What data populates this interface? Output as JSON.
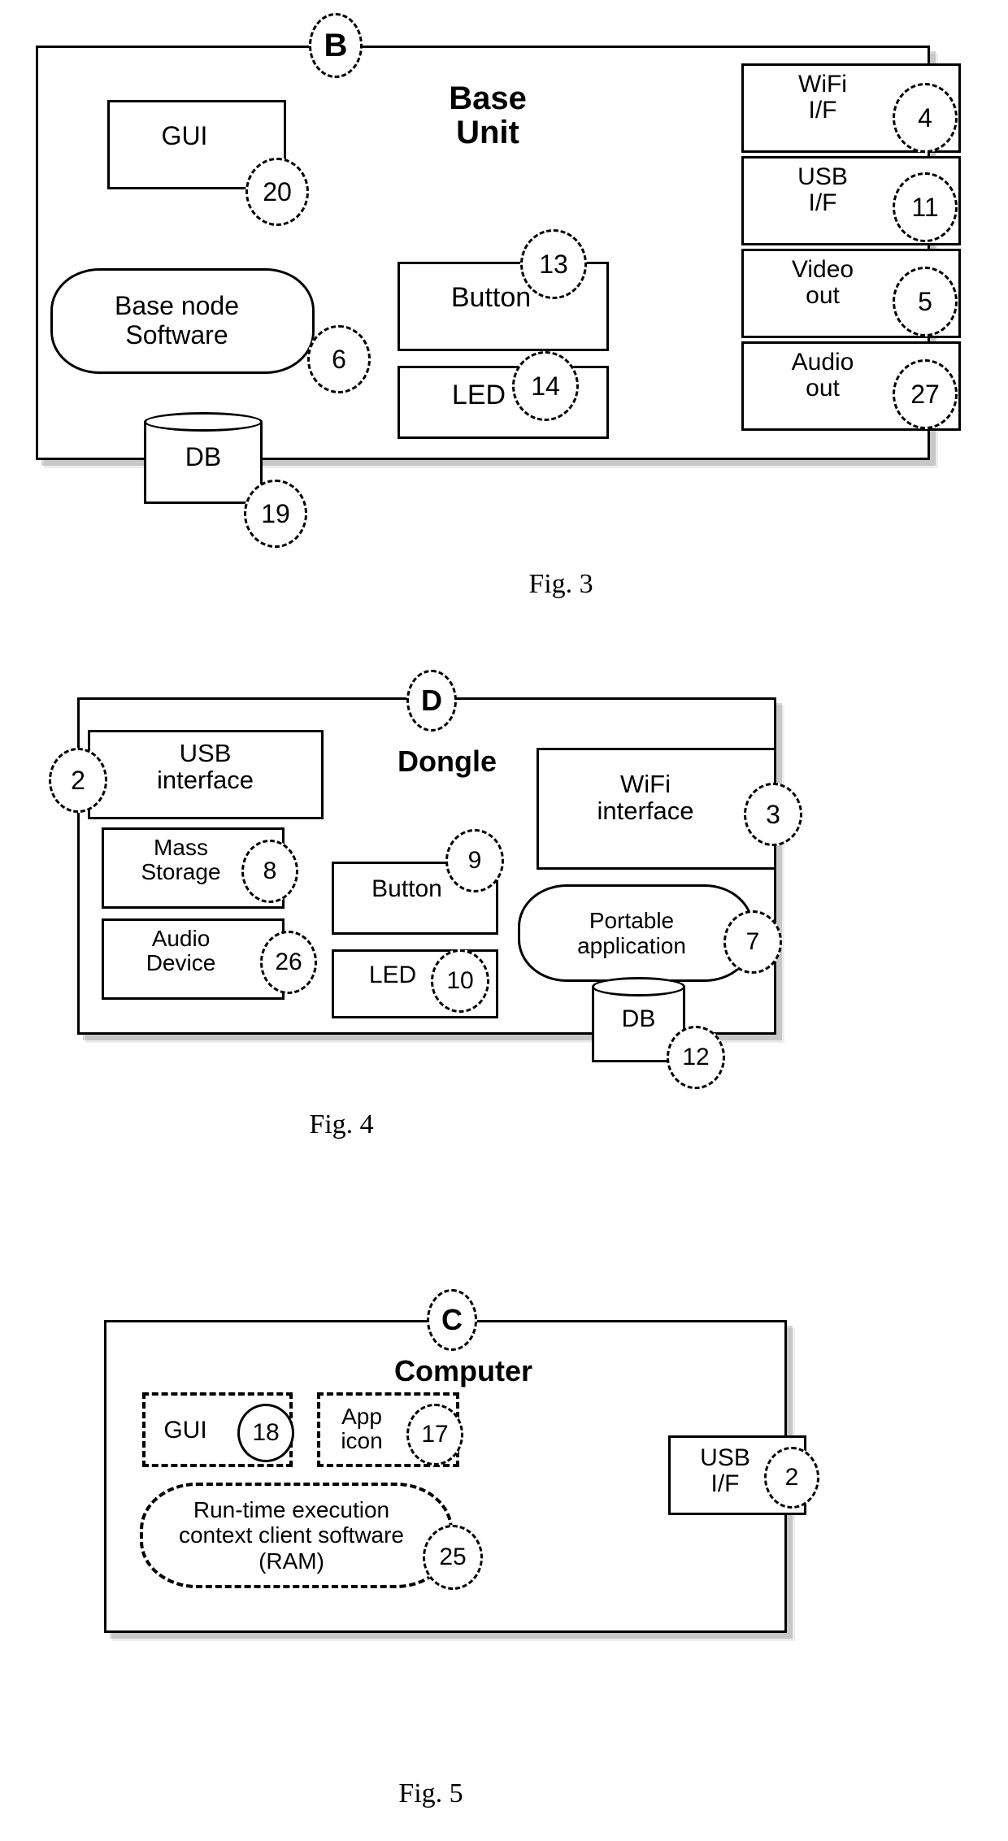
{
  "figures": [
    {
      "id": "fig3",
      "marker": "B",
      "title": "Base\nUnit",
      "caption": "Fig. 3",
      "blocks": [
        {
          "name": "gui",
          "label": "GUI",
          "ref": "20"
        },
        {
          "name": "base-node-sw",
          "label": "Base node\nSoftware",
          "ref": "6"
        },
        {
          "name": "db",
          "label": "DB",
          "ref": "19"
        },
        {
          "name": "button",
          "label": "Button",
          "ref": "13"
        },
        {
          "name": "led",
          "label": "LED",
          "ref": "14"
        },
        {
          "name": "wifi-if",
          "label": "WiFi\nI/F",
          "ref": "4"
        },
        {
          "name": "usb-if",
          "label": "USB\nI/F",
          "ref": "11"
        },
        {
          "name": "video-out",
          "label": "Video\nout",
          "ref": "5"
        },
        {
          "name": "audio-out",
          "label": "Audio\nout",
          "ref": "27"
        }
      ]
    },
    {
      "id": "fig4",
      "marker": "D",
      "title": "Dongle",
      "caption": "Fig. 4",
      "blocks": [
        {
          "name": "usb-interface",
          "label": "USB\ninterface",
          "ref": "2"
        },
        {
          "name": "mass-storage",
          "label": "Mass\nStorage",
          "ref": "8"
        },
        {
          "name": "audio-device",
          "label": "Audio\nDevice",
          "ref": "26"
        },
        {
          "name": "button",
          "label": "Button",
          "ref": "9"
        },
        {
          "name": "led",
          "label": "LED",
          "ref": "10"
        },
        {
          "name": "wifi-interface",
          "label": "WiFi\ninterface",
          "ref": "3"
        },
        {
          "name": "portable-app",
          "label": "Portable\napplication",
          "ref": "7"
        },
        {
          "name": "db",
          "label": "DB",
          "ref": "12"
        }
      ]
    },
    {
      "id": "fig5",
      "marker": "C",
      "title": "Computer",
      "caption": "Fig. 5",
      "blocks": [
        {
          "name": "gui",
          "label": "GUI",
          "ref": "18"
        },
        {
          "name": "app-icon",
          "label": "App\nicon",
          "ref": "17"
        },
        {
          "name": "runtime-context",
          "label": "Run-time execution\ncontext client software\n(RAM)",
          "ref": "25"
        },
        {
          "name": "usb-if",
          "label": "USB\nI/F",
          "ref": "2"
        }
      ]
    }
  ],
  "colors": {
    "ink": "#000000",
    "paper": "#ffffff"
  }
}
